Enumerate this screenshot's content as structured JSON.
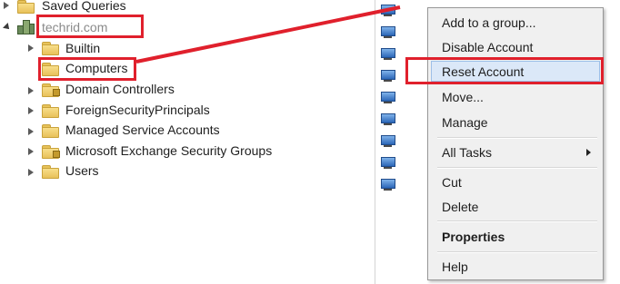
{
  "tree": {
    "saved_queries": "Saved Queries",
    "domain": "techrid.com",
    "ous": {
      "builtin": "Builtin",
      "computers": "Computers",
      "domain_controllers": "Domain Controllers",
      "foreign_security_principals": "ForeignSecurityPrincipals",
      "managed_service_accounts": "Managed Service Accounts",
      "exchange_security_groups": "Microsoft Exchange Security Groups",
      "users": "Users"
    }
  },
  "context_menu": {
    "add_to_group": "Add to a group...",
    "disable_account": "Disable Account",
    "reset_account": "Reset Account",
    "move": "Move...",
    "manage": "Manage",
    "all_tasks": "All Tasks",
    "cut": "Cut",
    "delete": "Delete",
    "properties": "Properties",
    "help": "Help"
  },
  "colors": {
    "highlight_box": "#e0202c",
    "menu_highlight": "#dbe8f8",
    "folder": "#e8c15a"
  },
  "icons": [
    "folder-icon",
    "domain-icon",
    "computer-icon",
    "submenu-arrow-icon",
    "expand-arrow-icon"
  ]
}
